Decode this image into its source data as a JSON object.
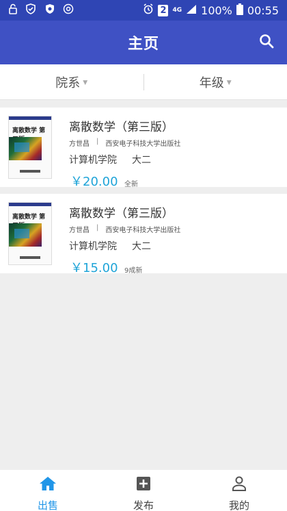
{
  "status_bar": {
    "notifications": [
      "lock-icon",
      "shield-check-icon",
      "shield-badge-icon",
      "target-icon"
    ],
    "sim_badge": "2",
    "network": "4G",
    "battery": "100%",
    "time": "00:55"
  },
  "app_bar": {
    "title": "主页",
    "search_icon": "search-icon"
  },
  "filters": [
    {
      "label": "院系"
    },
    {
      "label": "年级"
    }
  ],
  "books": [
    {
      "title": "离散数学（第三版）",
      "author": "方世昌",
      "separator": "|",
      "publisher": "西安电子科技大学出版社",
      "college": "计算机学院",
      "grade": "大二",
      "price": "￥20.00",
      "condition": "全新"
    },
    {
      "title": "离散数学（第三版）",
      "author": "方世昌",
      "separator": "|",
      "publisher": "西安电子科技大学出版社",
      "college": "计算机学院",
      "grade": "大二",
      "price": "￥15.00",
      "condition": "9成新"
    }
  ],
  "tabs": [
    {
      "label": "出售",
      "icon": "home-icon",
      "active": true
    },
    {
      "label": "发布",
      "icon": "add-box-icon",
      "active": false
    },
    {
      "label": "我的",
      "icon": "person-icon",
      "active": false
    }
  ],
  "colors": {
    "status_bar": "#2f45b4",
    "app_bar": "#3f51c4",
    "accent": "#2196e8",
    "price": "#1fa4d8",
    "background": "#eeeeee"
  }
}
